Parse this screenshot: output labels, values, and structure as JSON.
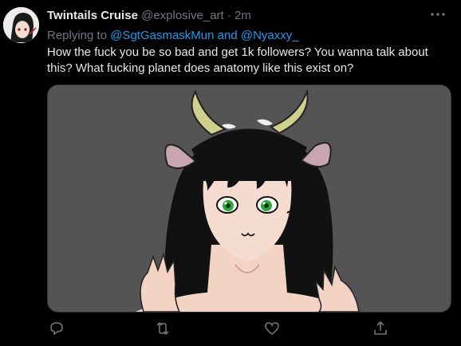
{
  "tweet": {
    "display_name": "Twintails Cruise",
    "handle": "@explosive_art",
    "separator": "·",
    "time": "2m",
    "replying_prefix": "Replying to ",
    "reply_mention_1": "@SgtGasmaskMun",
    "reply_and": " and ",
    "reply_mention_2": "@Nyaxxy_",
    "text": "How the fuck you be so bad and get 1k followers? You wanna talk about this? What fucking planet does anatomy like this exist on?"
  },
  "icons": {
    "more": "more-dots-icon",
    "reply": "reply-bubble-icon",
    "retweet": "retweet-icon",
    "like": "heart-icon",
    "share": "share-icon"
  },
  "colors": {
    "background": "#000000",
    "text_primary": "#e7e9ea",
    "text_secondary": "#71767b",
    "link": "#1d9bf0",
    "media_background": "#545454"
  }
}
